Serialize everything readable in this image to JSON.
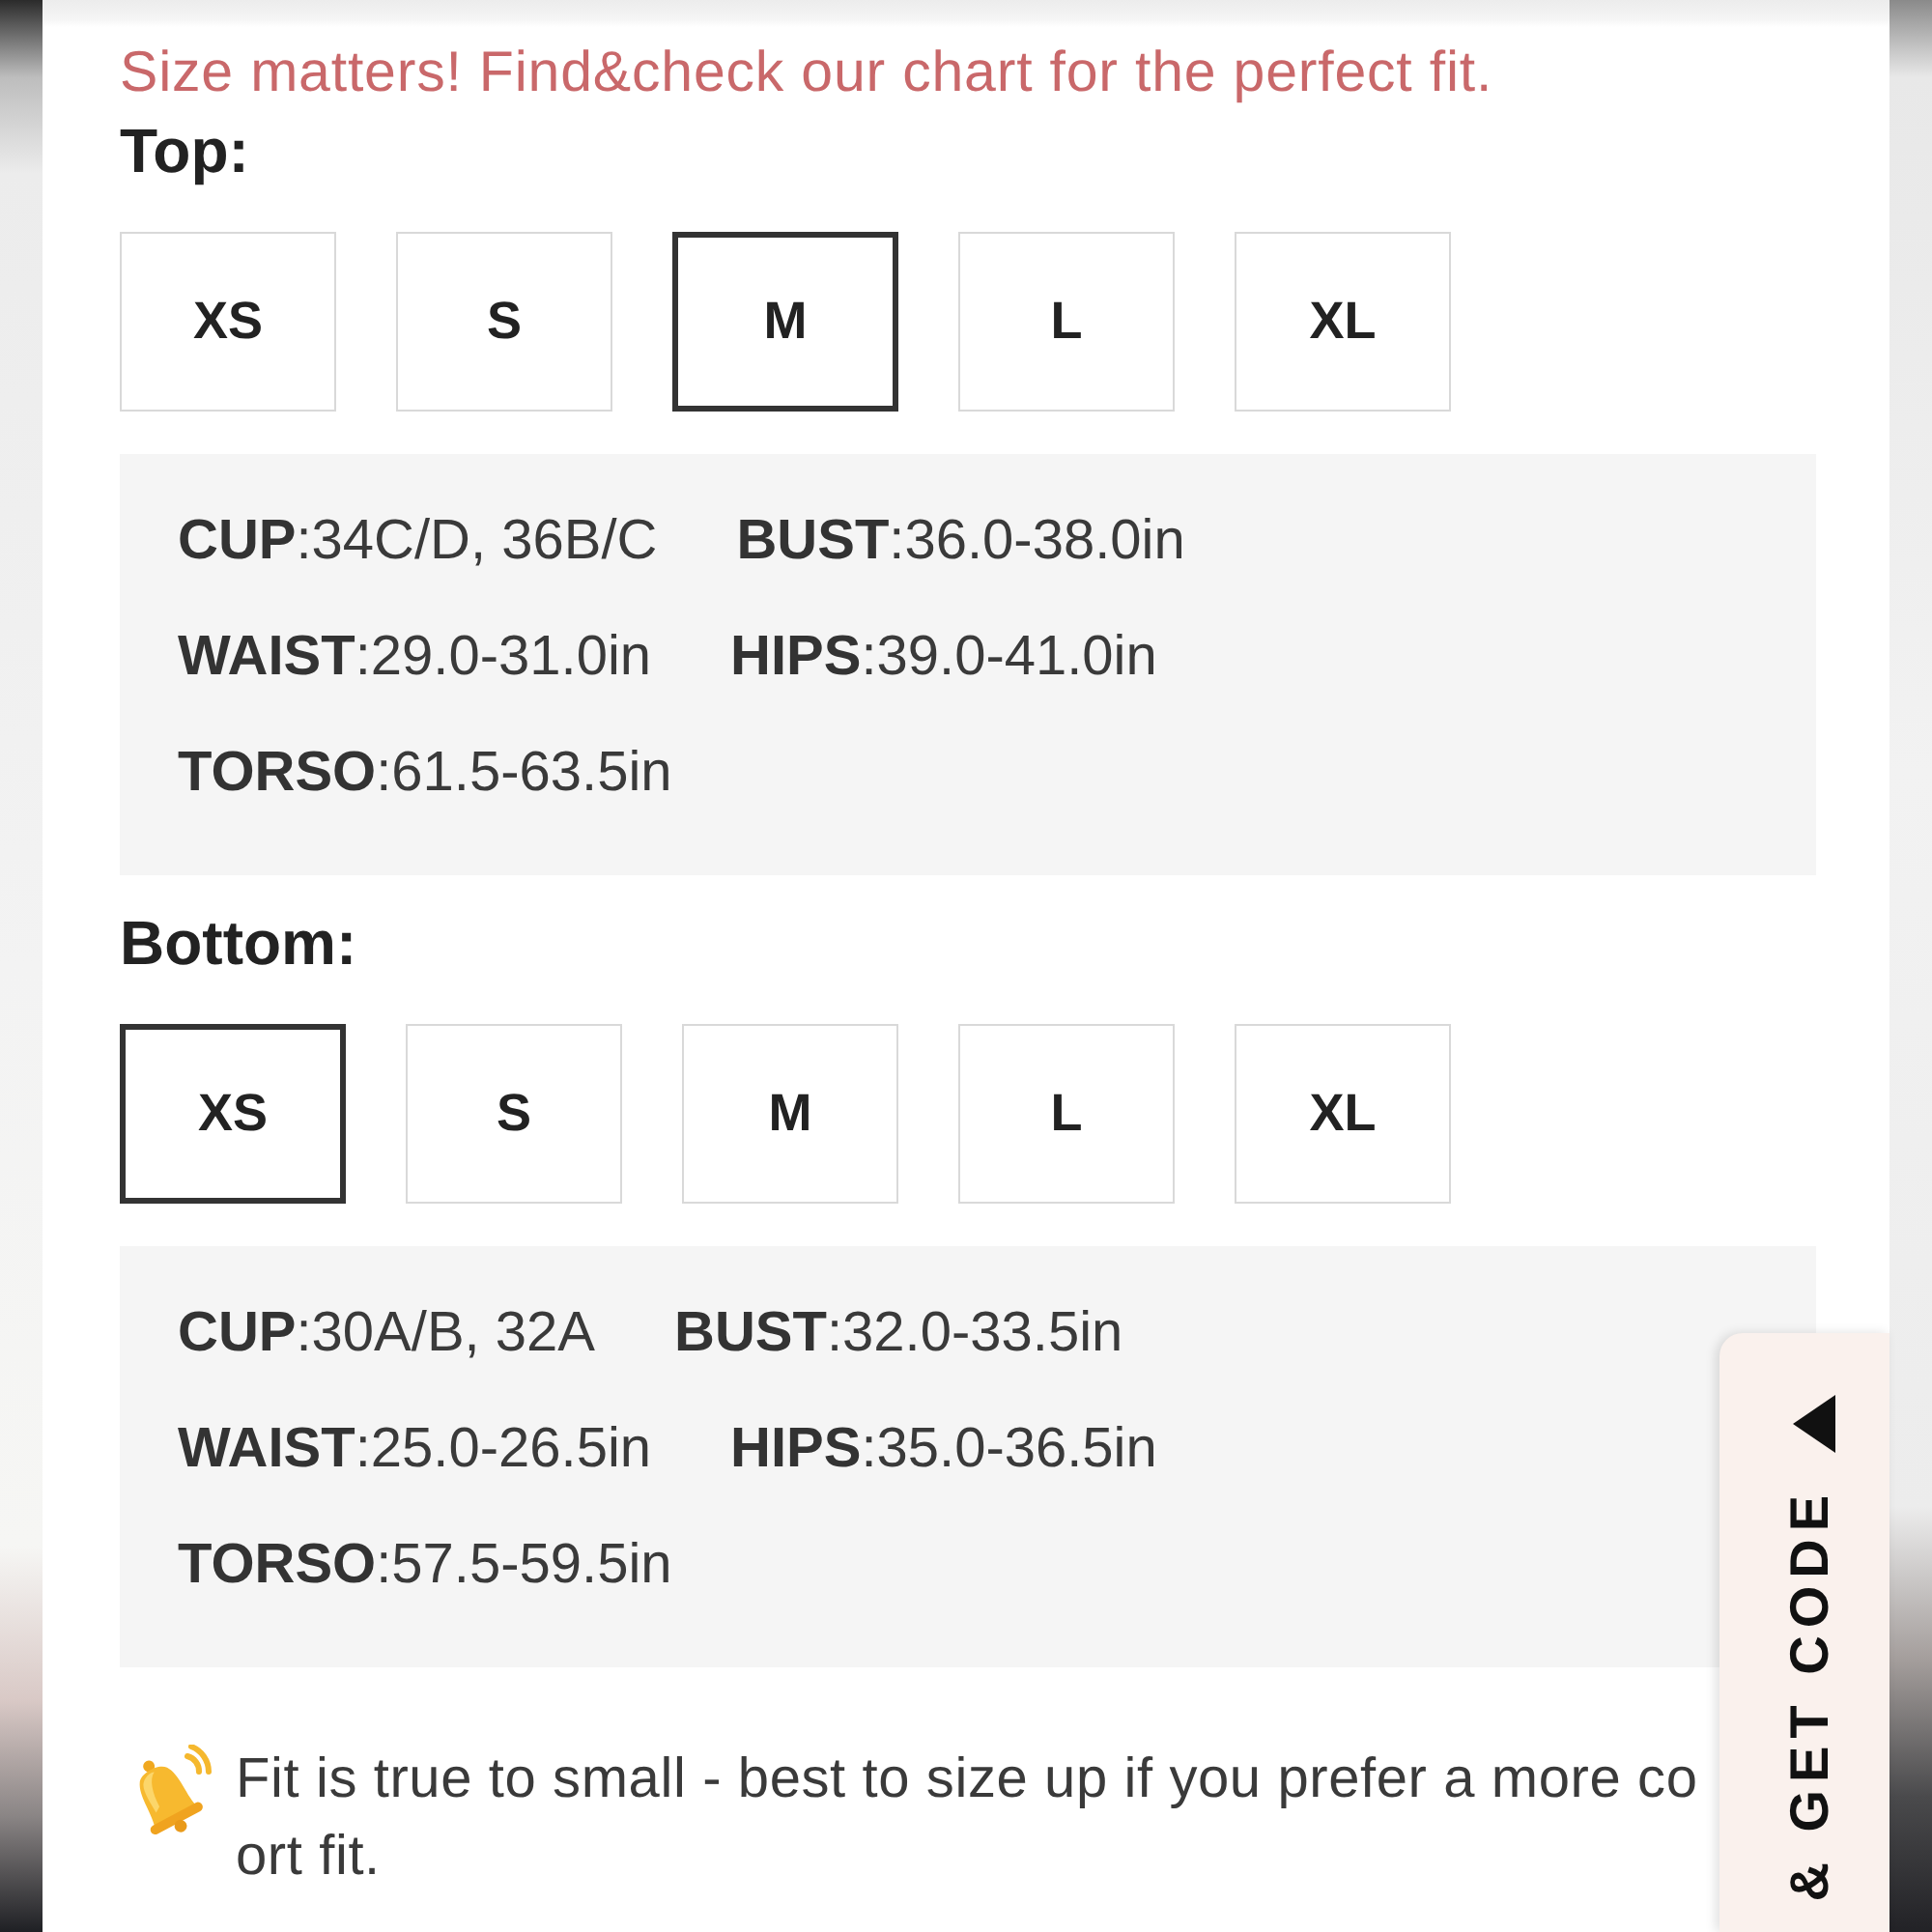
{
  "intro": "Size matters! Find&check our chart for the perfect fit.",
  "sections": [
    {
      "title": "Top:",
      "sizes": [
        {
          "label": "XS",
          "selected": false
        },
        {
          "label": "S",
          "selected": false
        },
        {
          "label": "M",
          "selected": true
        },
        {
          "label": "L",
          "selected": false
        },
        {
          "label": "XL",
          "selected": false
        }
      ],
      "details": [
        [
          "**CUP**:34C/D, 36B/C",
          "**BUST**:36.0-38.0in"
        ],
        [
          "**WAIST**:29.0-31.0in",
          "**HIPS**:39.0-41.0in"
        ],
        [
          "**TORSO**:61.5-63.5in"
        ]
      ]
    },
    {
      "title": "Bottom:",
      "sizes": [
        {
          "label": "XS",
          "selected": true
        },
        {
          "label": "S",
          "selected": false
        },
        {
          "label": "M",
          "selected": false
        },
        {
          "label": "L",
          "selected": false
        },
        {
          "label": "XL",
          "selected": false
        }
      ],
      "details": [
        [
          "**CUP**:30A/B, 32A",
          "**BUST**:32.0-33.5in"
        ],
        [
          "**WAIST**:25.0-26.5in",
          "**HIPS**:35.0-36.5in"
        ],
        [
          "**TORSO**:57.5-59.5in"
        ]
      ]
    }
  ],
  "note": {
    "lines": [
      "Fit is true to small - best to size up if you prefer a more co",
      "ort fit."
    ]
  },
  "promo_tab": {
    "label": "& GET CODE"
  }
}
